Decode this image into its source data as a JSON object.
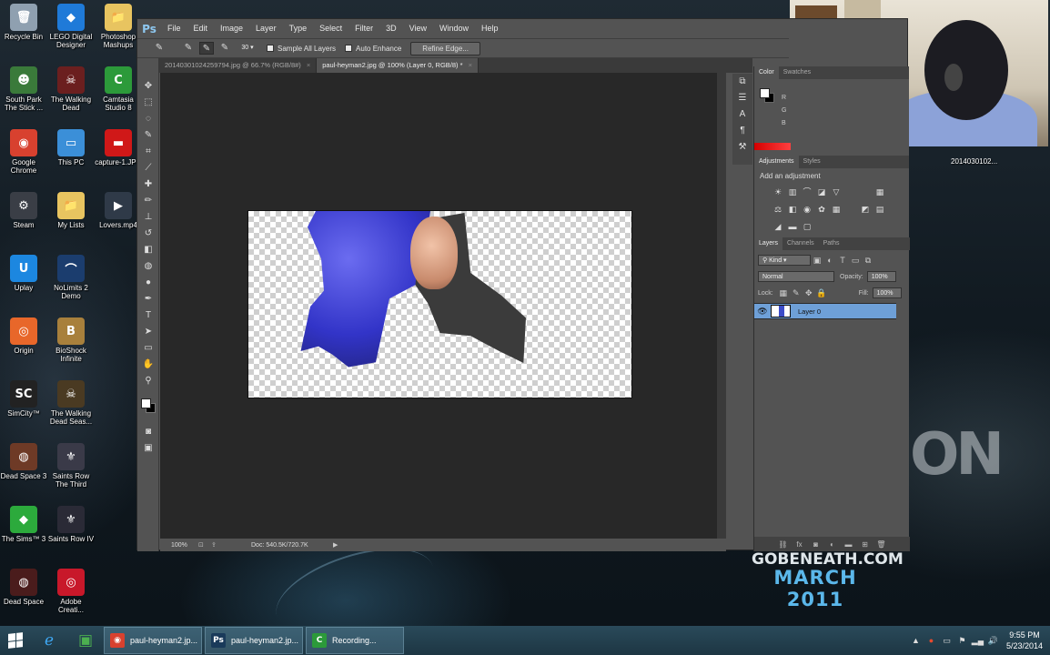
{
  "desktop": {
    "icons": [
      {
        "label": "Recycle Bin",
        "glyph": "🗑",
        "color": "#8fa0b0"
      },
      {
        "label": "LEGO Digital Designer",
        "glyph": "◆",
        "color": "#1f7ad8"
      },
      {
        "label": "Photoshop Mashups",
        "glyph": "📁",
        "color": "#e8c460"
      },
      {
        "label": "South Park The Stick ...",
        "glyph": "☻",
        "color": "#3a7a3a"
      },
      {
        "label": "The Walking Dead",
        "glyph": "☠",
        "color": "#6b1f1f"
      },
      {
        "label": "Camtasia Studio 8",
        "glyph": "C",
        "color": "#2c9a3a"
      },
      {
        "label": "Google Chrome",
        "glyph": "◉",
        "color": "#d8412f"
      },
      {
        "label": "This PC",
        "glyph": "▭",
        "color": "#3b8fd8"
      },
      {
        "label": "capture-1.JPG",
        "glyph": "▬",
        "color": "#d01818"
      },
      {
        "label": "Steam",
        "glyph": "⚙",
        "color": "#3a3e46"
      },
      {
        "label": "My Lists",
        "glyph": "📁",
        "color": "#e8c460"
      },
      {
        "label": "Lovers.mp4",
        "glyph": "▶",
        "color": "#2f3a48"
      },
      {
        "label": "Uplay",
        "glyph": "U",
        "color": "#1c87e0"
      },
      {
        "label": "NoLimits 2 Demo",
        "glyph": "⌒",
        "color": "#1b3d6e"
      },
      {
        "label": "Origin",
        "glyph": "◎",
        "color": "#e8672a"
      },
      {
        "label": "BioShock Infinite",
        "glyph": "B",
        "color": "#a8803c"
      },
      {
        "label": "SimCity™",
        "glyph": "SC",
        "color": "#222222"
      },
      {
        "label": "The Walking Dead Seas...",
        "glyph": "☠",
        "color": "#4a3a22"
      },
      {
        "label": "Dead Space 3",
        "glyph": "◍",
        "color": "#6e3a26"
      },
      {
        "label": "Saints Row The Third",
        "glyph": "⚜",
        "color": "#3a3a48"
      },
      {
        "label": "The Sims™ 3",
        "glyph": "◆",
        "color": "#2caa3c"
      },
      {
        "label": "Saints Row IV",
        "glyph": "⚜",
        "color": "#2a2a36"
      },
      {
        "label": "Dead Space",
        "glyph": "◍",
        "color": "#4a1c1c"
      },
      {
        "label": "Adobe Creati...",
        "glyph": "◎",
        "color": "#c8182a"
      }
    ],
    "wallpaper_logo": "ON",
    "promo_line1": "GOBENEATH.COM",
    "promo_line2": "MARCH 2011",
    "webcam_label": "2014030102..."
  },
  "photoshop": {
    "logo": "Ps",
    "menu": [
      "File",
      "Edit",
      "Image",
      "Layer",
      "Type",
      "Select",
      "Filter",
      "3D",
      "View",
      "Window",
      "Help"
    ],
    "options": {
      "brush_size": "30",
      "sample_all_layers": "Sample All Layers",
      "auto_enhance": "Auto Enhance",
      "refine_edge": "Refine Edge..."
    },
    "tabs": [
      {
        "label": "20140301024259794.jpg @ 66.7% (RGB/8#)",
        "active": false
      },
      {
        "label": "paul-heyman2.jpg @ 100% (Layer 0, RGB/8) *",
        "active": true
      }
    ],
    "tab_close": "×",
    "status": {
      "zoom": "100%",
      "doc": "Doc: 540.5K/720.7K",
      "arrow": "▶"
    },
    "color_panel": {
      "tabs": [
        "Color",
        "Swatches"
      ],
      "r": "R",
      "g": "G",
      "b": "B"
    },
    "adjustments": {
      "tabs": [
        "Adjustments",
        "Styles"
      ],
      "title": "Add an adjustment"
    },
    "layers_panel": {
      "tabs": [
        "Layers",
        "Channels",
        "Paths"
      ],
      "kind": "Kind",
      "blend_mode": "Normal",
      "opacity_label": "Opacity:",
      "opacity_value": "100%",
      "lock_label": "Lock:",
      "fill_label": "Fill:",
      "fill_value": "100%",
      "layer_name": "Layer 0"
    }
  },
  "taskbar": {
    "tasks": [
      {
        "label": "paul-heyman2.jp...",
        "icon": "◉",
        "color": "#d8412f"
      },
      {
        "label": "paul-heyman2.jp...",
        "icon": "Ps",
        "color": "#1a3a5a"
      },
      {
        "label": "Recording...",
        "icon": "C",
        "color": "#2c9a3a"
      }
    ],
    "time": "9:55 PM",
    "date": "5/23/2014"
  }
}
